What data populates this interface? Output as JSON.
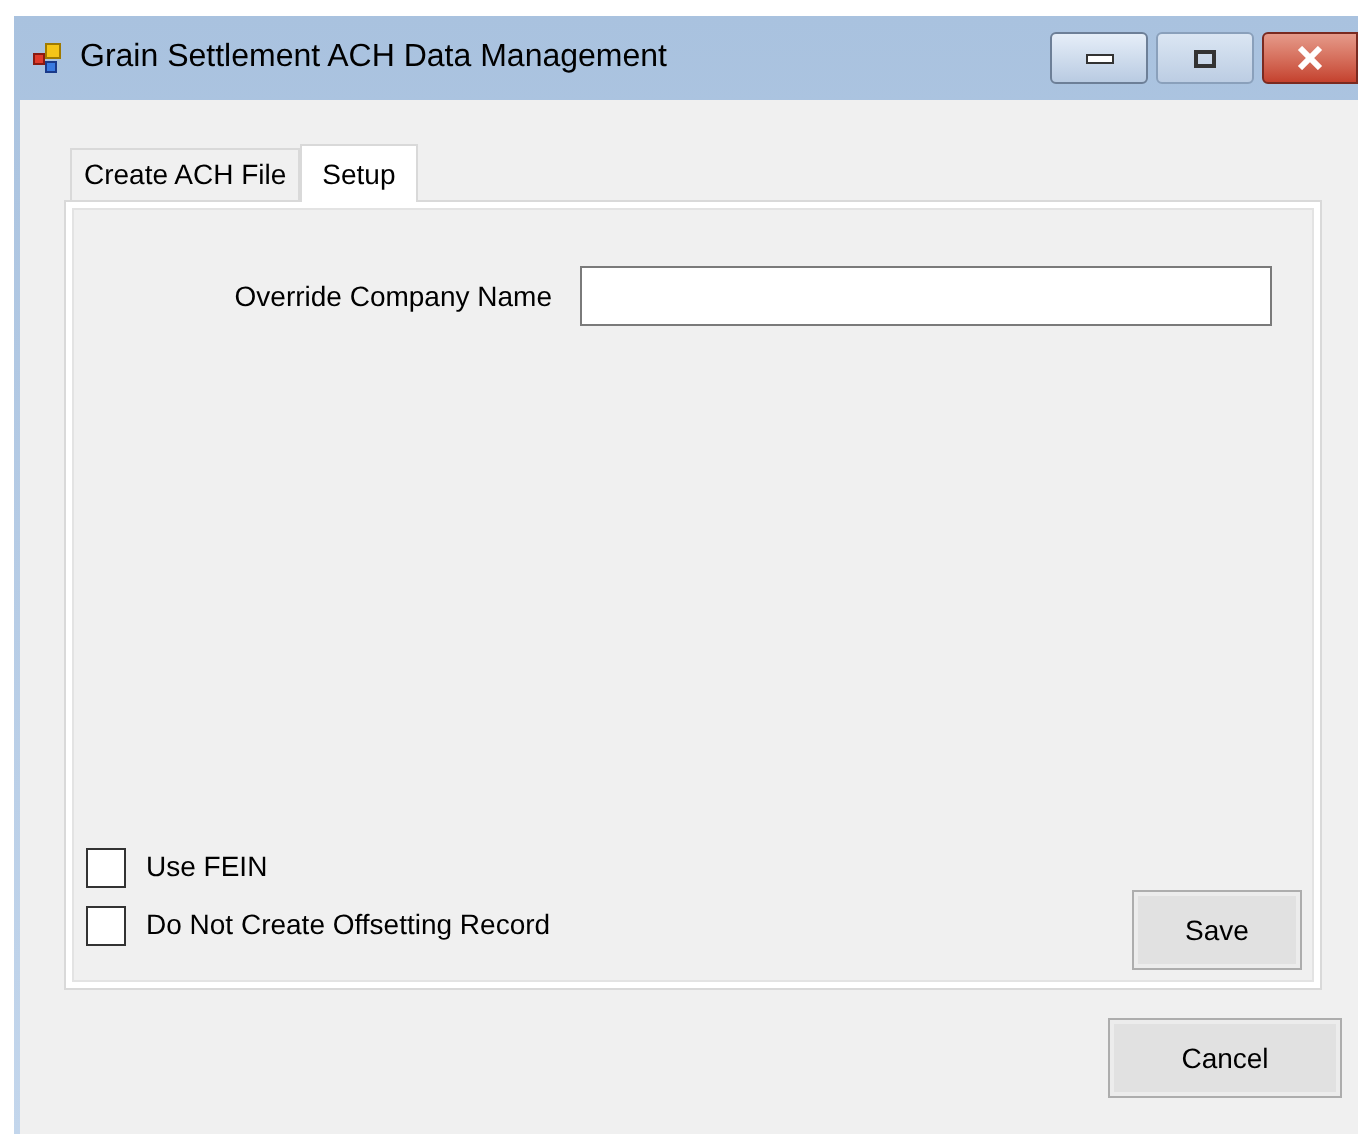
{
  "window": {
    "title": "Grain Settlement ACH Data Management"
  },
  "tabs": [
    {
      "label": "Create ACH File",
      "selected": false
    },
    {
      "label": "Setup",
      "selected": true
    }
  ],
  "override_company_name": {
    "label": "Override Company Name"
  },
  "checkboxes": [
    {
      "label": "Use FEIN",
      "checked": false
    },
    {
      "label": "Do Not Create Offsetting Record",
      "checked": false
    }
  ],
  "save_button": "Save",
  "cancel_button": "Cancel"
}
